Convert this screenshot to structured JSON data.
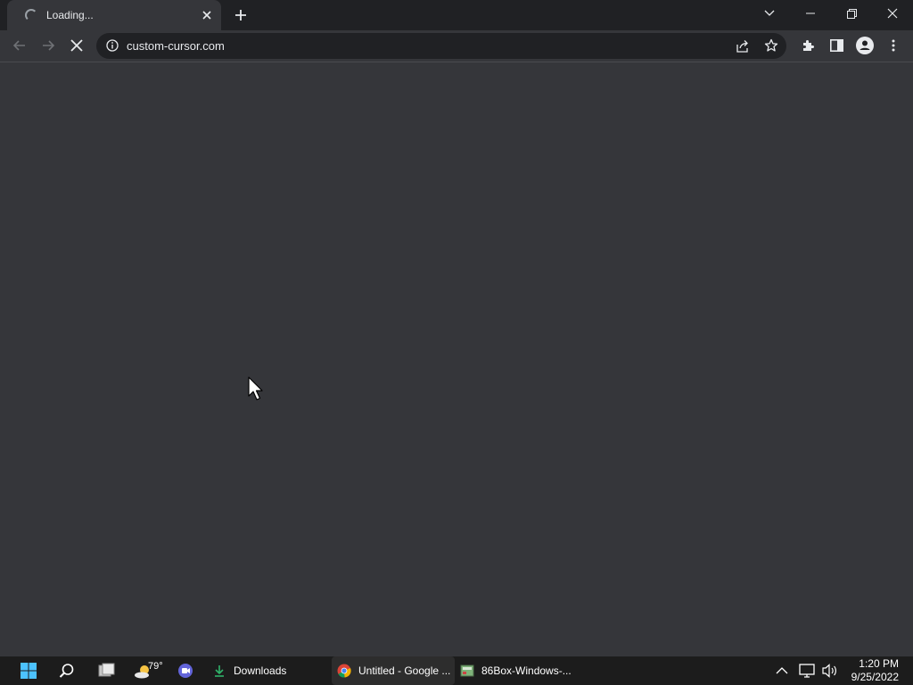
{
  "browser": {
    "tab": {
      "title": "Loading...",
      "icon": "loading-spinner-icon"
    },
    "new_tab_icon": "plus-icon",
    "window_controls": [
      "chevron-down-icon",
      "minimize-icon",
      "restore-icon",
      "close-icon"
    ],
    "toolbar": {
      "url": "custom-cursor.com",
      "icons": [
        "back-arrow-icon",
        "forward-arrow-icon",
        "stop-icon",
        "info-icon",
        "share-icon",
        "star-icon",
        "extensions-icon",
        "side-panel-icon",
        "profile-icon",
        "more-menu-icon"
      ]
    }
  },
  "taskbar": {
    "weather": {
      "temp": "79°"
    },
    "items": [
      {
        "label": "Downloads",
        "icon": "download-icon"
      },
      {
        "label": "Untitled - Google ...",
        "icon": "chrome-icon"
      },
      {
        "label": "86Box-Windows-...",
        "icon": "app-icon"
      }
    ],
    "clock": {
      "time": "1:20 PM",
      "date": "9/25/2022"
    }
  },
  "colors": {
    "titlebar": "#202124",
    "toolbar": "#35363a",
    "omnibox": "#202124",
    "taskbar": "#1c1c1c",
    "windows_blue": "#4cc2ff"
  }
}
